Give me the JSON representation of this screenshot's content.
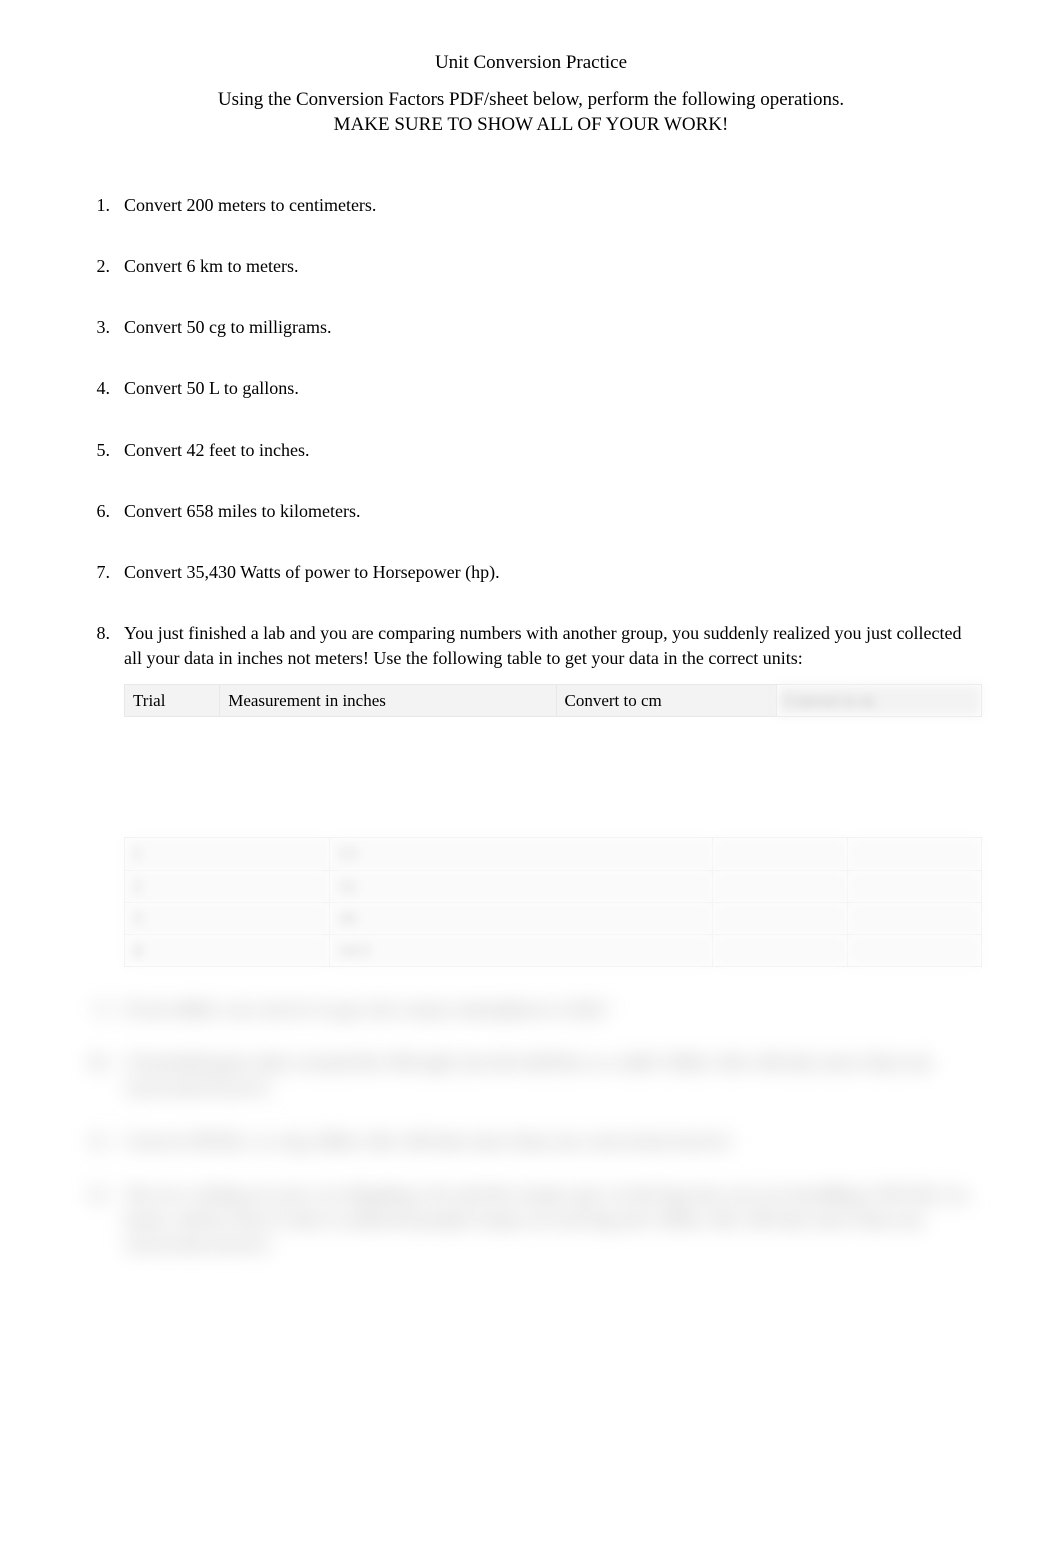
{
  "title": "Unit Conversion Practice",
  "subtitle_line1": "Using the Conversion Factors PDF/sheet below, perform the following operations.",
  "subtitle_line2": "MAKE SURE TO SHOW ALL OF YOUR WORK!",
  "questions": [
    {
      "num": "1.",
      "text": "Convert 200 meters to centimeters."
    },
    {
      "num": "2.",
      "text": "Convert 6 km to meters."
    },
    {
      "num": "3.",
      "text": "Convert 50 cg to milligrams."
    },
    {
      "num": "4.",
      "text": "Convert 50 L to gallons."
    },
    {
      "num": "5.",
      "text": "Convert 42 feet to inches."
    },
    {
      "num": "6.",
      "text": "Convert 658 miles to kilometers."
    },
    {
      "num": "7.",
      "text": "Convert 35,430 Watts of power to Horsepower (hp)."
    },
    {
      "num": "8.",
      "text": "You just finished a lab and you are comparing numbers with another group, you suddenly realized you just collected all your data in inches not meters!  Use the following table to get your data in the correct units:"
    }
  ],
  "table": {
    "headers": [
      "Trial",
      "Measurement in inches",
      "Convert to cm",
      "Convert to m"
    ]
  },
  "blurred_questions": [
    {
      "num": "9.",
      "text": "If one dollar can convert to gas, how many atmospheres is this?"
    },
    {
      "num": "10.",
      "text": "A baseball game takes around the 100 mph, but the ball hits as a mile? (Hint: this will take more than one conversion factor!)"
    },
    {
      "num": "11.",
      "text": "Convert 850 lbs. so a kg. (Hint: this will take more than one conversion factor!)"
    },
    {
      "num": "12.",
      "text": "You are waiting on your car shopping a lot and the torque spec on the lug nuts you are installing is 89 ft.lb. (i.e. many calories does it take to unloosed people torque on each lug nut? (Hint: this will take more than one conversion factor!)"
    }
  ]
}
